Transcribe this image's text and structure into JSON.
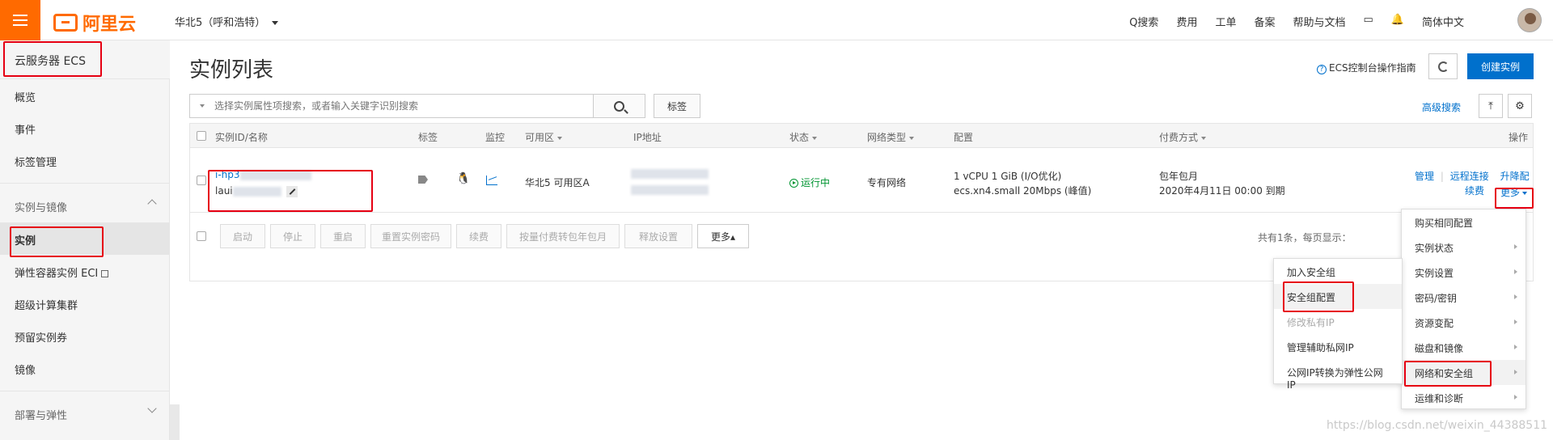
{
  "topbar": {
    "logo_text": "阿里云",
    "region": "华北5（呼和浩特）",
    "nav": [
      "搜索",
      "费用",
      "工单",
      "备案",
      "帮助与文档",
      "简体中文"
    ],
    "colors": {
      "brand": "#ff6a00",
      "accent": "#0070cc",
      "highlight": "#e60012"
    }
  },
  "sidebar": {
    "title": "云服务器 ECS",
    "items_top": [
      "概览",
      "事件",
      "标签管理"
    ],
    "group1": "实例与镜像",
    "items_group1": [
      "实例",
      "弹性容器实例 ECI",
      "超级计算集群",
      "预留实例券",
      "镜像"
    ],
    "group2": "部署与弹性"
  },
  "main": {
    "title": "实例列表",
    "guide": "ECS控制台操作指南",
    "create_btn": "创建实例",
    "search_placeholder": "选择实例属性项搜索，或者输入关键字识别搜索",
    "tag_btn": "标签",
    "adv_search": "高级搜索"
  },
  "table": {
    "headers": {
      "id": "实例ID/名称",
      "tag": "标签",
      "monitor": "监控",
      "zone": "可用区",
      "ip": "IP地址",
      "status": "状态",
      "network": "网络类型",
      "config": "配置",
      "billing": "付费方式",
      "ops": "操作"
    },
    "row": {
      "id": "i-hp3",
      "name": "laui",
      "zone": "华北5 可用区A",
      "status": "运行中",
      "network": "专有网络",
      "config_line1": "1 vCPU 1 GiB (I/O优化)",
      "config_line2": "ecs.xn4.small   20Mbps (峰值)",
      "billing_line1": "包年包月",
      "billing_line2": "2020年4月11日 00:00 到期",
      "ops": {
        "manage": "管理",
        "sep": "|",
        "remote": "远程连接",
        "upgrade": "升降配",
        "renew": "续费",
        "more": "更多"
      }
    },
    "footer_buttons": [
      "启动",
      "停止",
      "重启",
      "重置实例密码",
      "续费",
      "按量付费转包年包月",
      "释放设置",
      "更多▴"
    ],
    "pager_text": "共有1条，每页显示："
  },
  "dropdown_main": [
    "购买相同配置",
    "实例状态",
    "实例设置",
    "密码/密钥",
    "资源变配",
    "磁盘和镜像",
    "网络和安全组",
    "运维和诊断"
  ],
  "dropdown_sub": [
    "加入安全组",
    "安全组配置",
    "修改私有IP",
    "管理辅助私网IP",
    "公网IP转换为弹性公网IP"
  ],
  "watermark": "https://blog.csdn.net/weixin_44388511"
}
